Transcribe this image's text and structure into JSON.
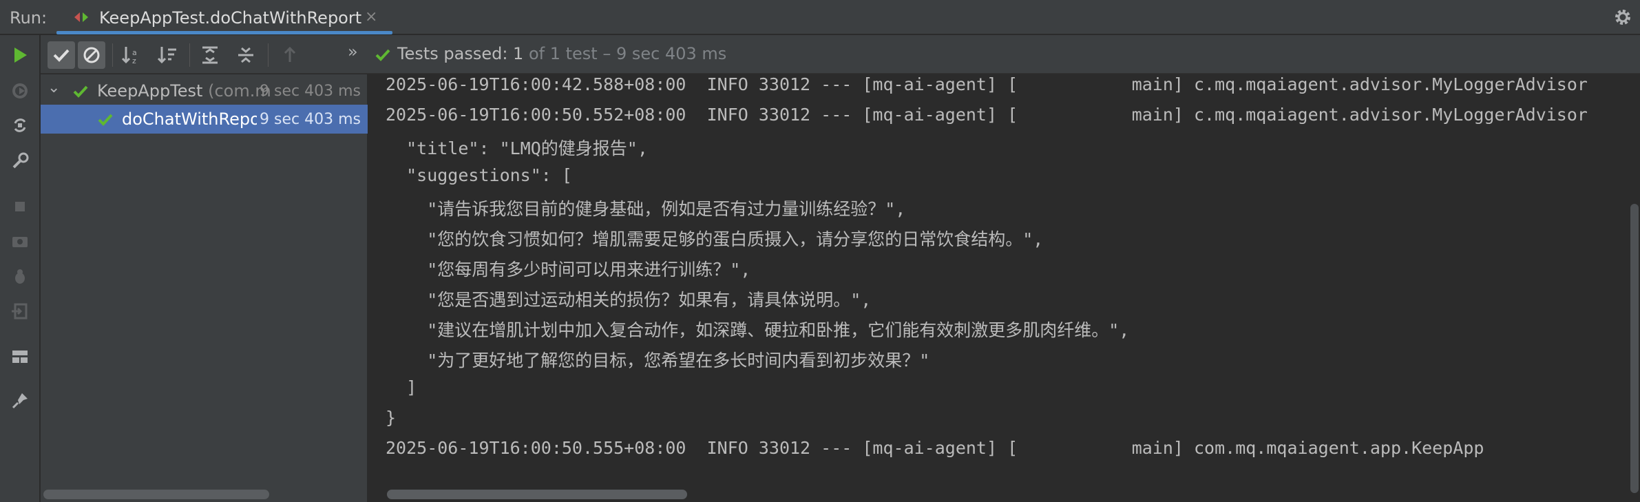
{
  "run_label": "Run:",
  "tab": {
    "title": "KeepAppTest.doChatWithReport",
    "close": "×"
  },
  "toolbar": {
    "status_passed": "Tests passed: 1",
    "status_detail": " of 1 test – 9 sec 403 ms",
    "more": "»"
  },
  "tree": {
    "items": [
      {
        "name": "KeepAppTest",
        "package": " (com.m",
        "time": "9 sec 403 ms",
        "expand": "⌄"
      },
      {
        "name": "doChatWithReport",
        "time": "9 sec 403 ms"
      }
    ]
  },
  "console": {
    "lines": [
      "2025-06-19T16:00:42.588+08:00  INFO 33012 --- [mq-ai-agent] [           main] c.mq.mqaiagent.advisor.MyLoggerAdvisor",
      "2025-06-19T16:00:50.552+08:00  INFO 33012 --- [mq-ai-agent] [           main] c.mq.mqaiagent.advisor.MyLoggerAdvisor",
      "  \"title\": \"LMQ的健身报告\",",
      "  \"suggestions\": [",
      "    \"请告诉我您目前的健身基础，例如是否有过力量训练经验？\",",
      "    \"您的饮食习惯如何？增肌需要足够的蛋白质摄入，请分享您的日常饮食结构。\",",
      "    \"您每周有多少时间可以用来进行训练？\",",
      "    \"您是否遇到过运动相关的损伤？如果有，请具体说明。\",",
      "    \"建议在增肌计划中加入复合动作，如深蹲、硬拉和卧推，它们能有效刺激更多肌肉纤维。\",",
      "    \"为了更好地了解您的目标，您希望在多长时间内看到初步效果？\"",
      "  ]",
      "}",
      "2025-06-19T16:00:50.555+08:00  INFO 33012 --- [mq-ai-agent] [           main] com.mq.mqaiagent.app.KeepApp"
    ]
  },
  "colors": {
    "accent": "#4a88c7",
    "pass_green": "#5fb832",
    "selection": "#4b6eaf"
  }
}
